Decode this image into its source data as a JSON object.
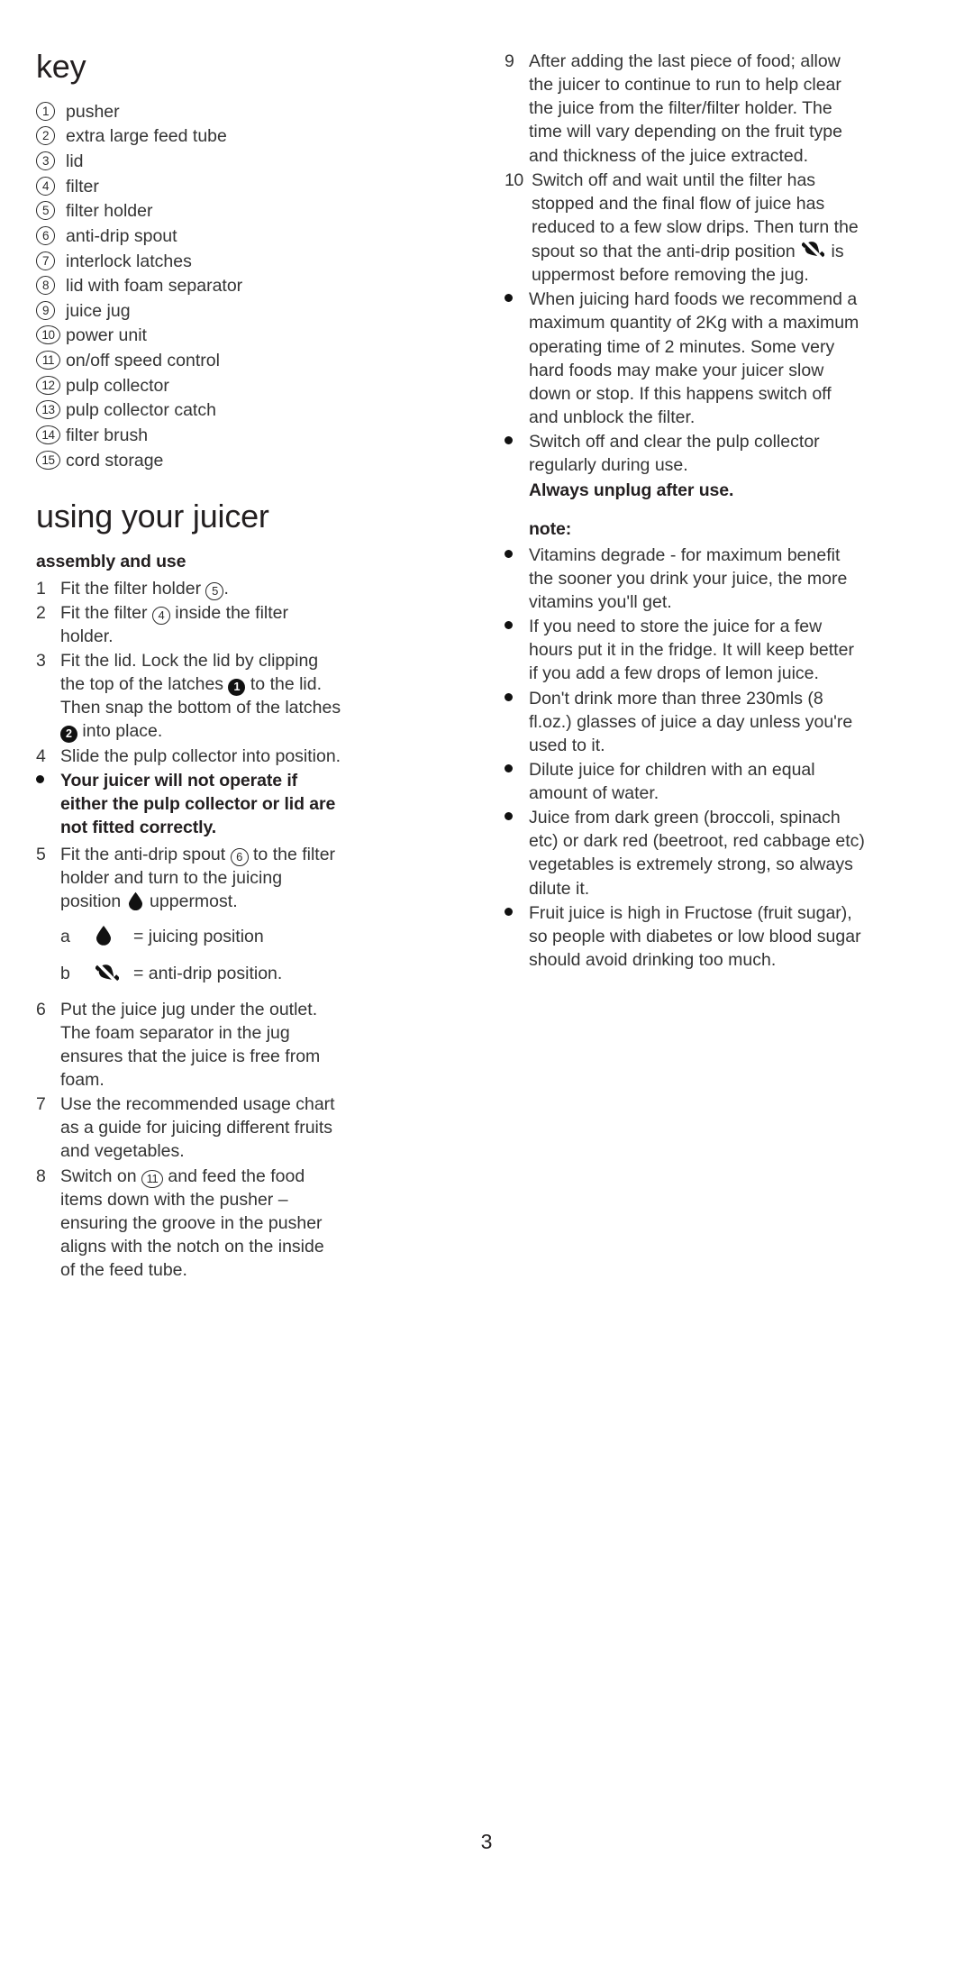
{
  "page": {
    "number": "3"
  },
  "left_column": {
    "key_heading": "key",
    "key_items": [
      {
        "num": "1",
        "label": "pusher"
      },
      {
        "num": "2",
        "label": "extra large feed tube"
      },
      {
        "num": "3",
        "label": "lid"
      },
      {
        "num": "4",
        "label": "filter"
      },
      {
        "num": "5",
        "label": "filter holder"
      },
      {
        "num": "6",
        "label": "anti-drip spout"
      },
      {
        "num": "7",
        "label": "interlock latches"
      },
      {
        "num": "8",
        "label": "lid with foam separator"
      },
      {
        "num": "9",
        "label": "juice jug"
      },
      {
        "num": "10",
        "label": "power unit"
      },
      {
        "num": "11",
        "label": "on/off speed control"
      },
      {
        "num": "12",
        "label": "pulp collector"
      },
      {
        "num": "13",
        "label": "pulp collector catch"
      },
      {
        "num": "14",
        "label": "filter brush"
      },
      {
        "num": "15",
        "label": "cord storage"
      }
    ],
    "using_heading": "using your juicer",
    "assembly_heading": "assembly and use",
    "steps": {
      "s1_num": "1",
      "s1_a": "Fit the filter holder ",
      "s1_ref": "5",
      "s1_b": ".",
      "s2_num": "2",
      "s2_a": "Fit the filter ",
      "s2_ref": "4",
      "s2_b": " inside the filter holder.",
      "s3_num": "3",
      "s3_a": "Fit the lid. Lock the lid by clipping the top of the latches ",
      "s3_ref1": "1",
      "s3_b": " to the lid. Then snap the bottom of the latches ",
      "s3_ref2": "2",
      "s3_c": " into place.",
      "s4_num": "4",
      "s4_text": "Slide the pulp collector into position.",
      "warn_text": "Your juicer will not operate if either the pulp collector or lid are not fitted correctly.",
      "s5_num": "5",
      "s5_a": "Fit the anti-drip spout ",
      "s5_ref": "6",
      "s5_b": " to the filter holder and turn to the juicing position ",
      "s5_c": " uppermost.",
      "ab_a_letter": "a",
      "ab_a_text": "= juicing position",
      "ab_b_letter": "b",
      "ab_b_text": "= anti-drip position.",
      "s6_num": "6",
      "s6_text": "Put the juice jug under the outlet. The foam separator in the jug ensures that the juice is free from foam.",
      "s7_num": "7",
      "s7_text": "Use the recommended usage chart as a guide for juicing different fruits and vegetables.",
      "s8_num": "8",
      "s8_a": "Switch on ",
      "s8_ref": "11",
      "s8_b": " and feed the food items down with the pusher – ensuring the groove in the pusher aligns with the notch on the inside of the feed tube."
    }
  },
  "right_column": {
    "steps": {
      "s9_num": "9",
      "s9_text": "After adding the last piece of food; allow the juicer to continue to run to help clear the juice from the filter/filter holder. The time will vary depending on the fruit type and thickness of the juice extracted.",
      "s10_num": "10",
      "s10_a": "Switch off and wait until the filter has stopped and the final flow of juice has reduced to a few slow drips. Then turn the spout so that the anti-drip position ",
      "s10_b": " is uppermost before removing the jug."
    },
    "bullets": [
      "When juicing hard foods we recommend a maximum quantity of 2Kg with a maximum operating time of 2 minutes. Some very hard foods may make your juicer slow down or stop. If this happens switch off and unblock the filter.",
      "Switch off and clear the pulp collector regularly during use."
    ],
    "unplug_heading": "Always unplug after use.",
    "note_heading": "note:",
    "note_bullets": [
      "Vitamins degrade - for maximum benefit the sooner you drink your juice, the more vitamins you'll get.",
      "If you need to store the juice for a few hours put it in the fridge. It will keep better if you add a few drops of lemon juice.",
      "Don't drink more than three 230mls (8 fl.oz.) glasses of juice a day unless you're used to it.",
      "Dilute juice for children with an equal amount of water.",
      "Juice from dark green (broccoli, spinach etc) or dark red (beetroot, red cabbage etc) vegetables is extremely strong, so always dilute it.",
      "Fruit juice is high in Fructose (fruit sugar), so people with diabetes or low blood sugar should avoid drinking too much."
    ]
  },
  "icons": {
    "juicing_position": "droplet-icon",
    "anti_drip_position": "droplet-slashed-icon",
    "bullet": "bullet-dot-icon"
  },
  "colors": {
    "text": "#343434",
    "heading": "#231f20",
    "background": "#ffffff"
  }
}
